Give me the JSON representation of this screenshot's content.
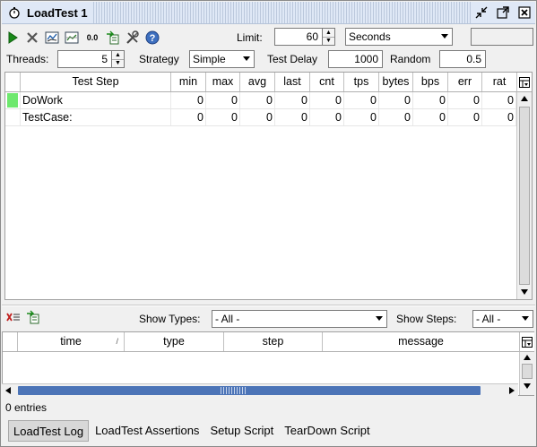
{
  "window": {
    "title": "LoadTest 1"
  },
  "toolbar": {
    "icons": [
      "run-icon",
      "cancel-icon",
      "chart-icon",
      "statistics-icon",
      "precision-icon",
      "export-icon",
      "options-icon",
      "help-icon"
    ],
    "precision_text": "0.0",
    "limit_label": "Limit:",
    "limit_value": "60",
    "limit_unit": "Seconds",
    "progress_text": ""
  },
  "settings": {
    "threads_label": "Threads:",
    "threads_value": "5",
    "strategy_label": "Strategy",
    "strategy_value": "Simple",
    "test_delay_label": "Test Delay",
    "test_delay_value": "1000",
    "random_label": "Random",
    "random_value": "0.5"
  },
  "stats_table": {
    "columns": [
      "Test Step",
      "min",
      "max",
      "avg",
      "last",
      "cnt",
      "tps",
      "bytes",
      "bps",
      "err",
      "rat"
    ],
    "rows": [
      {
        "name": "DoWork",
        "status_color": "#6ee86e",
        "values": [
          "0",
          "0",
          "0",
          "0",
          "0",
          "0",
          "0",
          "0",
          "0",
          "0"
        ]
      },
      {
        "name": "TestCase:",
        "status_color": "",
        "values": [
          "0",
          "0",
          "0",
          "0",
          "0",
          "0",
          "0",
          "0",
          "0",
          "0"
        ]
      }
    ]
  },
  "log": {
    "show_types_label": "Show Types:",
    "show_types_value": "- All -",
    "show_steps_label": "Show Steps:",
    "show_steps_value": "- All -",
    "columns": [
      "time",
      "type",
      "step",
      "message"
    ],
    "entries_text": "0 entries"
  },
  "tabs": [
    {
      "label": "LoadTest Log",
      "active": true
    },
    {
      "label": "LoadTest Assertions",
      "active": false
    },
    {
      "label": "Setup Script",
      "active": false
    },
    {
      "label": "TearDown Script",
      "active": false
    }
  ],
  "colors": {
    "titlebar": "#dfe8f6",
    "scroll_thumb": "#4c74b7",
    "status_ok": "#6ee86e"
  }
}
